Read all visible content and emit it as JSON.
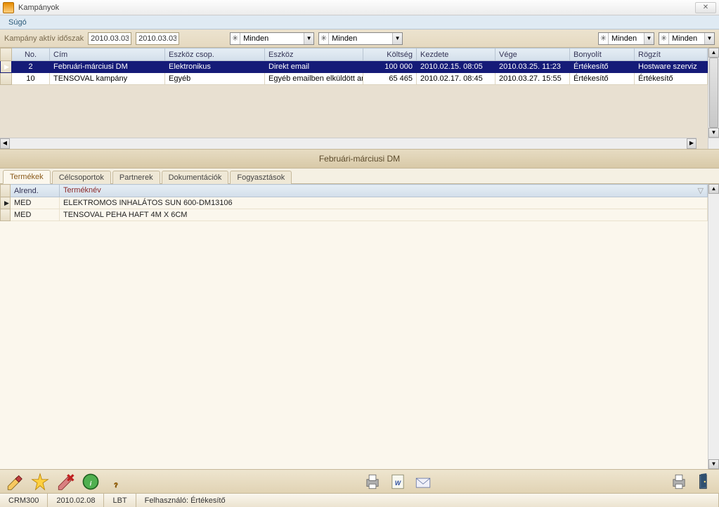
{
  "title": "Kampányok",
  "menu": {
    "sugo": "Súgó"
  },
  "filter": {
    "label": "Kampány aktív időszak",
    "date1": "2010.03.03",
    "date2": "2010.03.03",
    "combo1": "Minden",
    "combo2": "Minden",
    "combo3": "Minden",
    "combo4": "Minden"
  },
  "grid": {
    "headers": {
      "no": "No.",
      "cim": "Cím",
      "eszkcsop": "Eszköz csop.",
      "eszkoz": "Eszköz",
      "koltseg": "Költség",
      "kezdete": "Kezdete",
      "vege": "Vége",
      "bonyolit": "Bonyolít",
      "rogzit": "Rögzít"
    },
    "rows": [
      {
        "no": "2",
        "cim": "Februári-márciusi DM",
        "eszkcsop": "Elektronikus",
        "eszkoz": "Direkt email",
        "koltseg": "100 000",
        "kezdete": "2010.02.15. 08:05",
        "vege": "2010.03.25. 11:23",
        "bonyolit": "Értékesítő",
        "rogzit": "Hostware szerviz",
        "selected": true
      },
      {
        "no": "10",
        "cim": "TENSOVAL kampány",
        "eszkcsop": "Egyéb",
        "eszkoz": "Egyéb emailben elküldött any",
        "koltseg": "65 465",
        "kezdete": "2010.02.17. 08:45",
        "vege": "2010.03.27. 15:55",
        "bonyolit": "Értékesítő",
        "rogzit": "Értékesítő",
        "selected": false
      }
    ]
  },
  "separator": "Februári-márciusi DM",
  "tabs": {
    "termekek": "Termékek",
    "celcsoportok": "Célcsoportok",
    "partnerek": "Partnerek",
    "dokumentaciok": "Dokumentációk",
    "fogyasztasok": "Fogyasztások"
  },
  "detail": {
    "headers": {
      "alrend": "Alrend.",
      "termeknev": "Terméknév"
    },
    "rows": [
      {
        "alrend": "MED",
        "termeknev": "ELEKTROMOS INHALÁTOS SUN 600-DM13106"
      },
      {
        "alrend": "MED",
        "termeknev": "TENSOVAL PEHA HAFT 4M  X 6CM"
      }
    ]
  },
  "status": {
    "c1": "CRM300",
    "c2": "2010.02.08",
    "c3": "LBT",
    "c4": "Felhasználó: Értékesítő"
  }
}
